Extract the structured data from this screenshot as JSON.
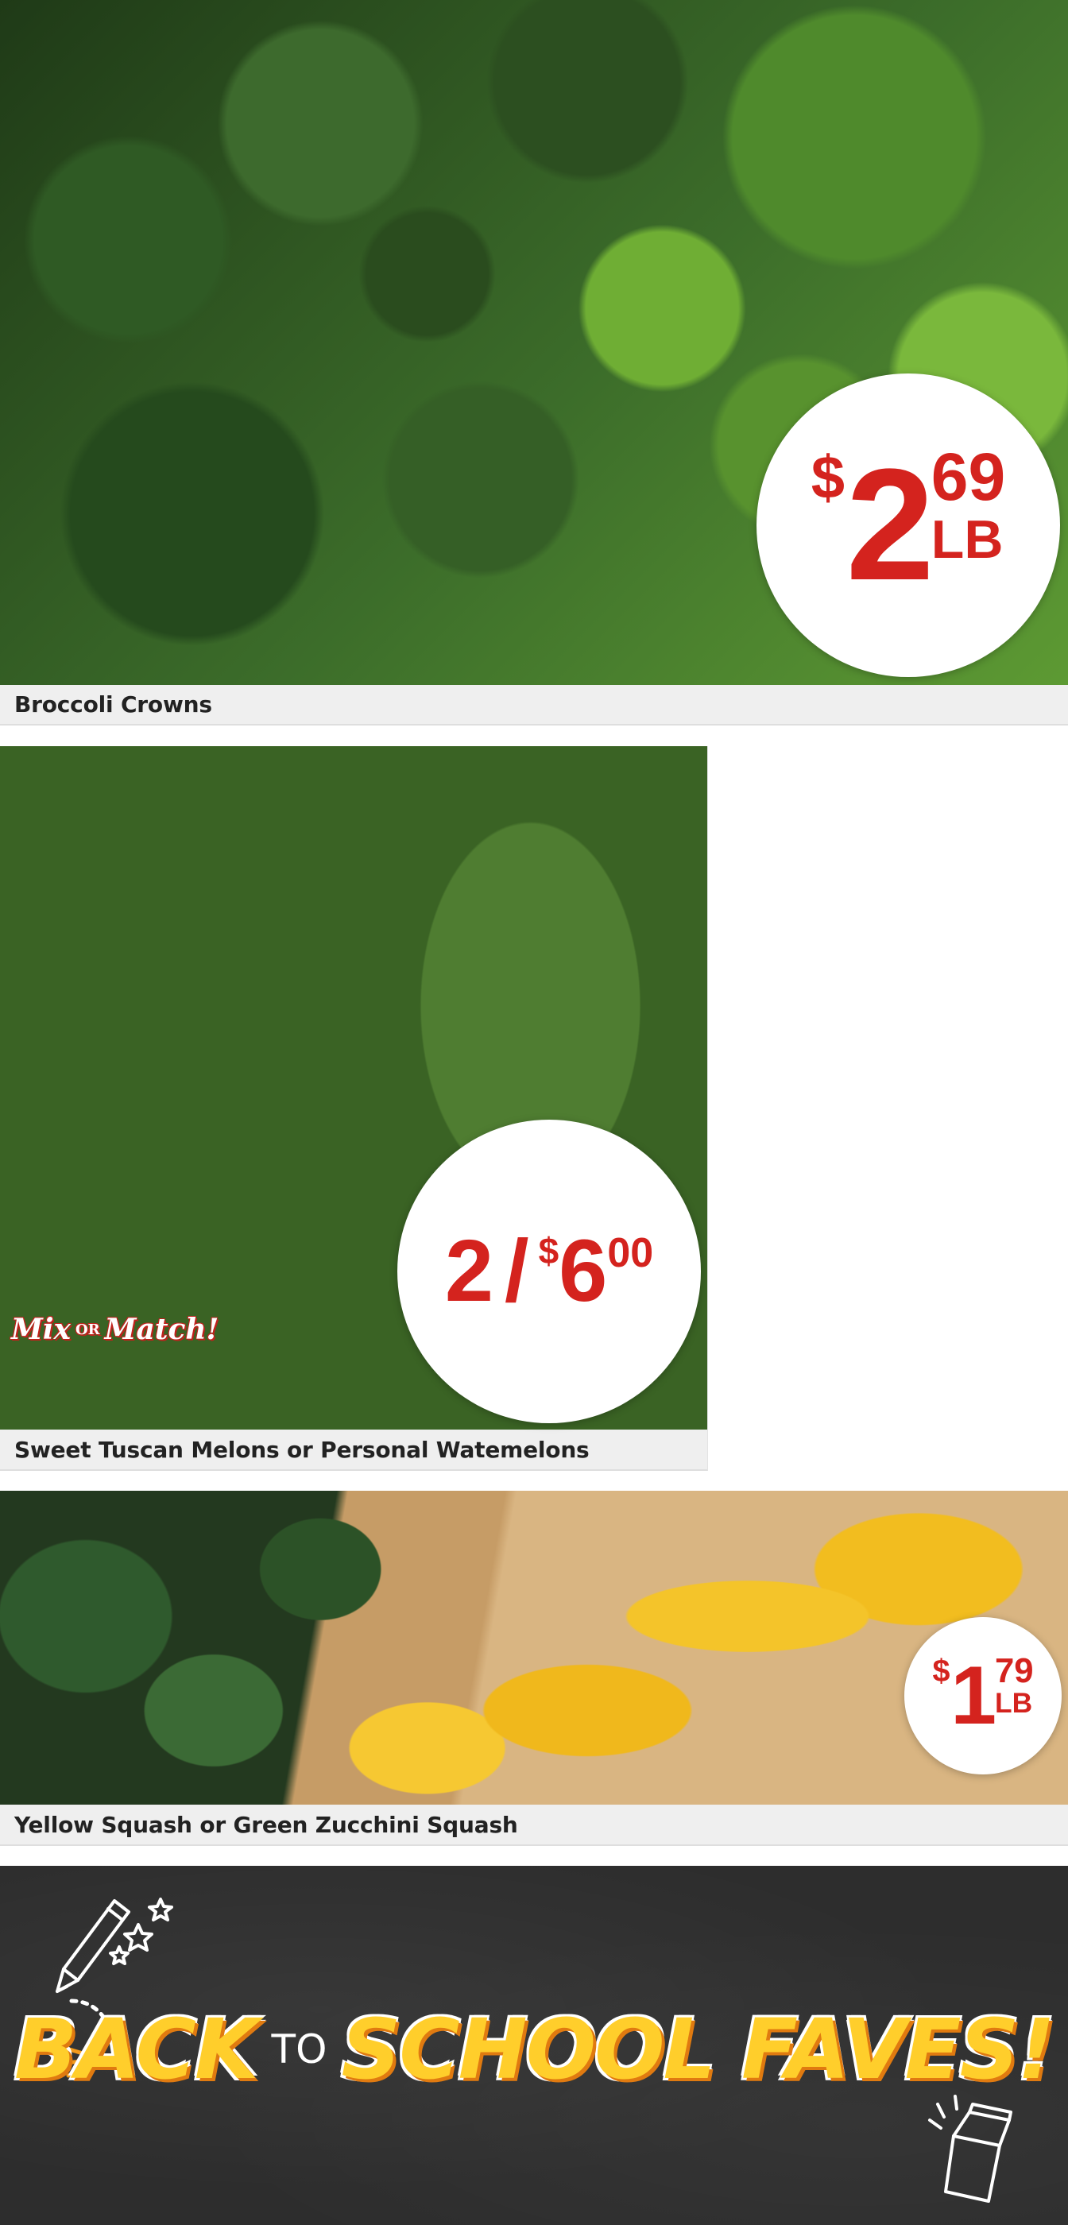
{
  "products": [
    {
      "name": "Broccoli Crowns",
      "price": {
        "dollar_sign": "$",
        "whole": "2",
        "cents": "69",
        "unit": "LB"
      }
    },
    {
      "name": "Sweet Tuscan Melons or Personal Watemelons",
      "price": {
        "quantity": "2",
        "separator": "/",
        "dollar_sign": "$",
        "whole": "6",
        "cents": "00"
      },
      "promo_tag": {
        "word1": "Mix",
        "connector": "OR",
        "word2": "Match!"
      }
    },
    {
      "name": "Yellow Squash or Green Zucchini Squash",
      "price": {
        "dollar_sign": "$",
        "whole": "1",
        "cents": "79",
        "unit": "LB"
      }
    }
  ],
  "banner": {
    "word1": "BACK",
    "word2": "TO",
    "word3": "SCHOOL FAVES!"
  },
  "colors": {
    "price_red": "#d4231e",
    "caption_bg": "#efefef",
    "chalkboard": "#2d2d2d",
    "banner_yellow": "#ffce2b"
  }
}
